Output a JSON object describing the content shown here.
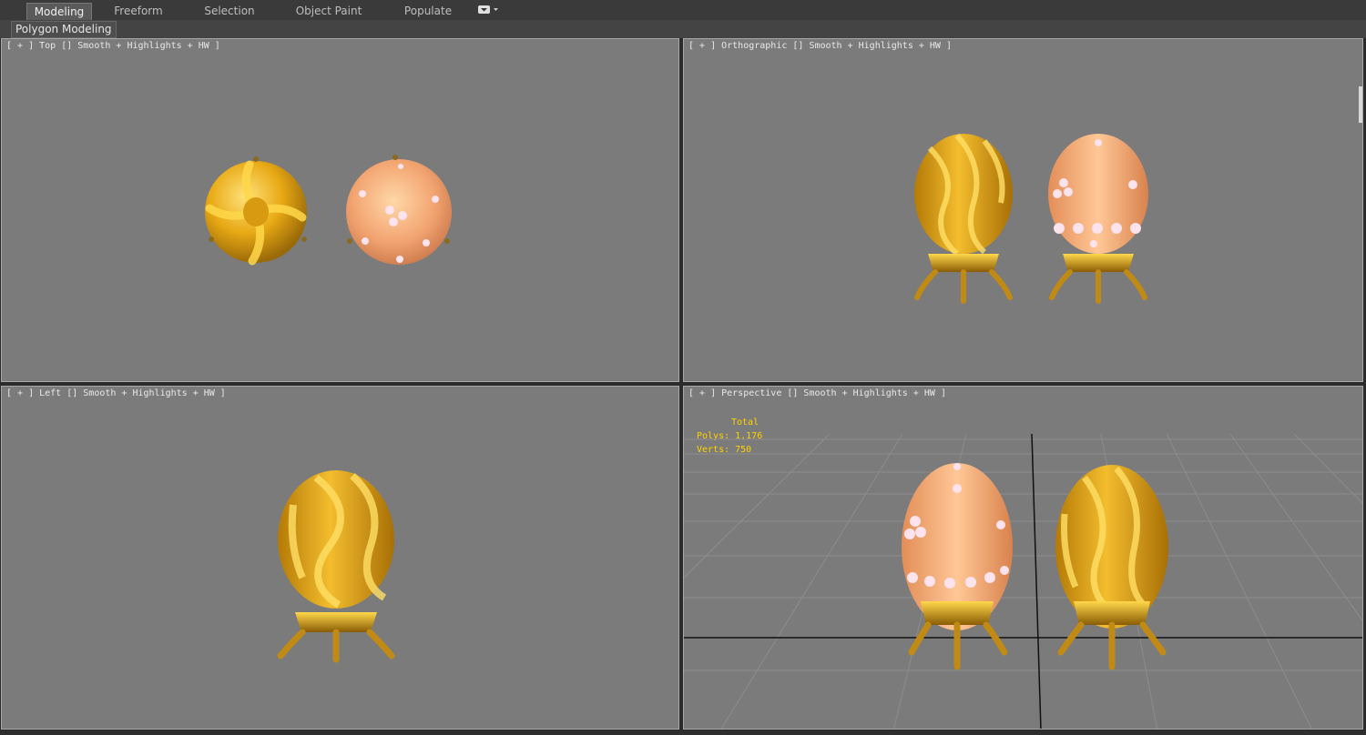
{
  "ribbon": {
    "tabs": [
      {
        "label": "Modeling",
        "active": true
      },
      {
        "label": "Freeform",
        "active": false
      },
      {
        "label": "Selection",
        "active": false
      },
      {
        "label": "Object Paint",
        "active": false
      },
      {
        "label": "Populate",
        "active": false
      }
    ],
    "options_icon": "dropdown-menu-icon",
    "panel_label": "Polygon Modeling"
  },
  "viewports": {
    "top": {
      "label": "[ + ] Top [] Smooth + Highlights + HW ]"
    },
    "ortho": {
      "label": "[ + ] Orthographic [] Smooth + Highlights + HW ]"
    },
    "left": {
      "label": "[ + ] Left [] Smooth + Highlights + HW ]"
    },
    "persp": {
      "label": "[ + ] Perspective [] Smooth + Highlights + HW ]"
    }
  },
  "stats": {
    "header": "Total",
    "polys": "Polys: 1,176",
    "verts": "Verts: 750"
  },
  "colors": {
    "viewport_bg": "#7b7b7b",
    "gold": "#e8a915",
    "peach": "#f2a470",
    "stats_text": "#ffd200"
  }
}
